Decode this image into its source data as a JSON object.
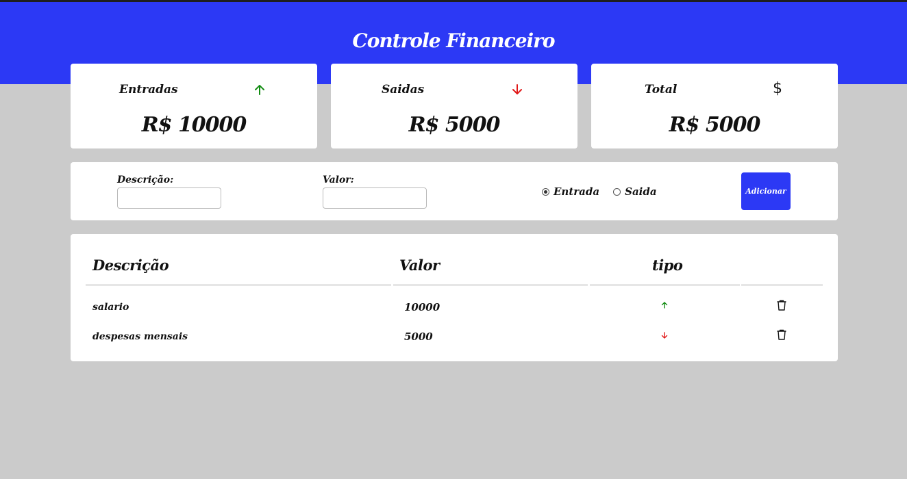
{
  "header": {
    "title": "Controle Financeiro",
    "color": "#2c39f5"
  },
  "summary": {
    "income": {
      "label": "Entradas",
      "value": "R$ 10000",
      "icon": "arrow-up-icon",
      "icon_color": "#128c12"
    },
    "expense": {
      "label": "Saidas",
      "value": "R$ 5000",
      "icon": "arrow-down-icon",
      "icon_color": "#e01818"
    },
    "total": {
      "label": "Total",
      "value": "R$ 5000",
      "icon": "dollar-icon",
      "symbol": "$"
    }
  },
  "form": {
    "description_label": "Descrição:",
    "description_value": "",
    "value_label": "Valor:",
    "value_value": "",
    "radios": [
      {
        "label": "Entrada",
        "checked": true
      },
      {
        "label": "Saida",
        "checked": false
      }
    ],
    "add_button": "Adicionar"
  },
  "table": {
    "headers": [
      "Descrição",
      "Valor",
      "tipo"
    ],
    "rows": [
      {
        "description": "salario",
        "value": "10000",
        "type": "entrada"
      },
      {
        "description": "despesas mensais",
        "value": "5000",
        "type": "saida"
      }
    ]
  }
}
